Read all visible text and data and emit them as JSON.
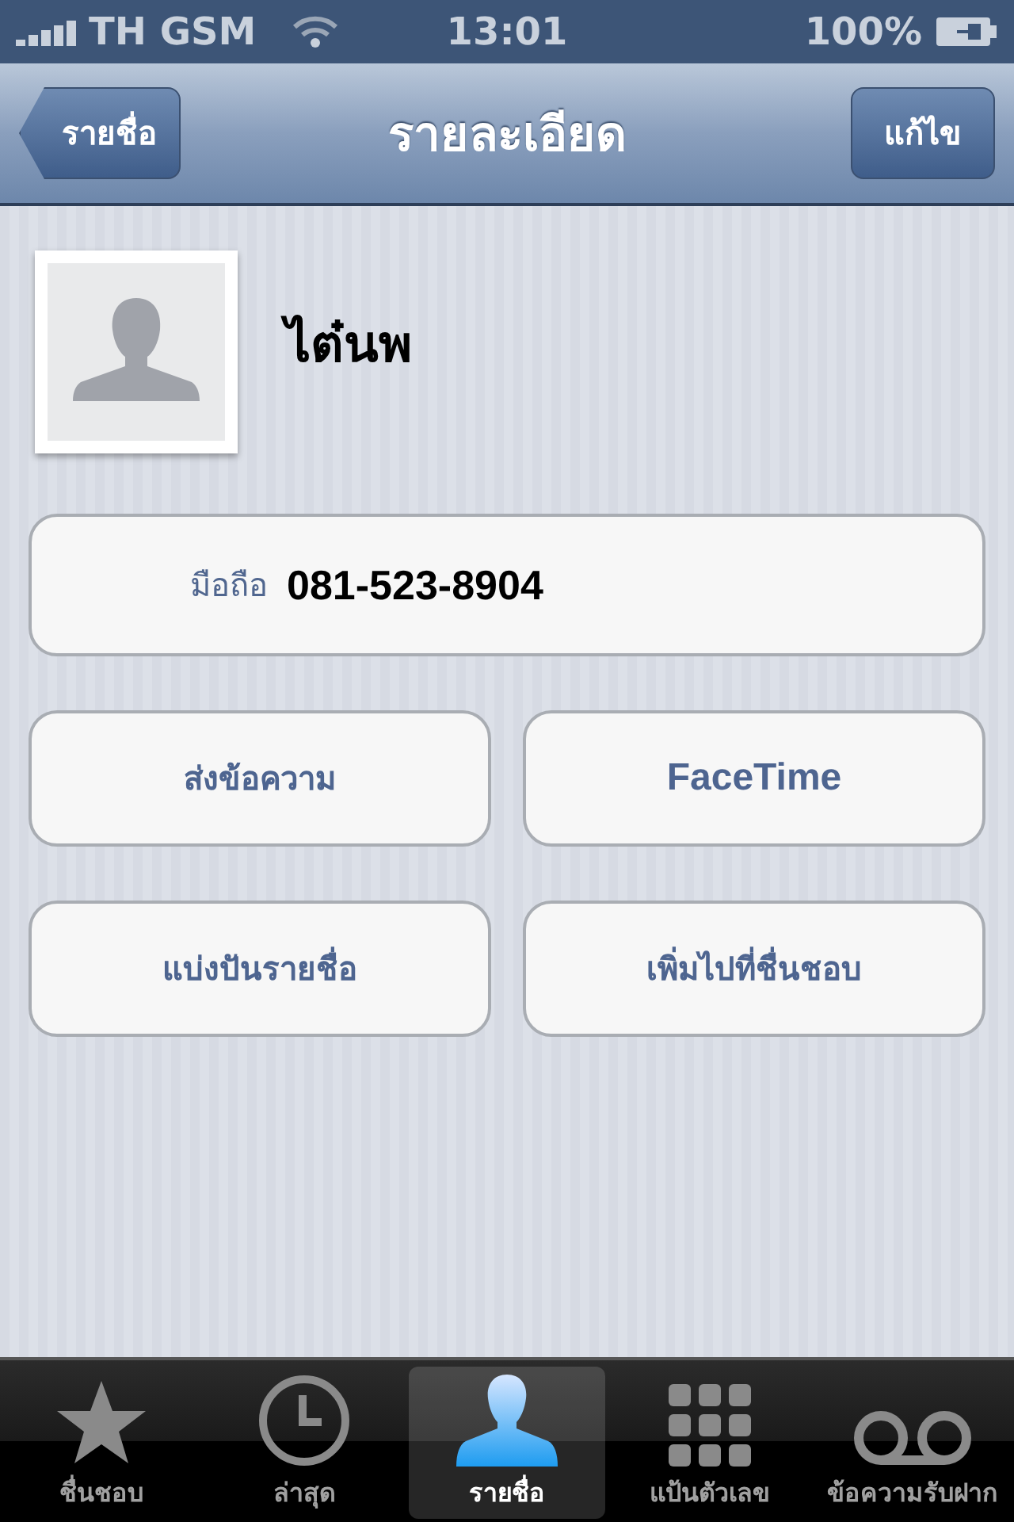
{
  "status_bar": {
    "carrier": "TH GSM",
    "time": "13:01",
    "battery": "100%"
  },
  "nav": {
    "back": "รายชื่อ",
    "title": "รายละเอียด",
    "edit": "แก้ไข"
  },
  "contact": {
    "name": "ไต๋นพ"
  },
  "phone": {
    "label": "มือถือ",
    "number": "081-523-8904"
  },
  "actions": [
    {
      "label": "ส่งข้อความ",
      "kind": "thai"
    },
    {
      "label": "FaceTime",
      "kind": "latin"
    },
    {
      "label": "แบ่งปันรายชื่อ",
      "kind": "thai"
    },
    {
      "label": "เพิ่มไปที่ชื่นชอบ",
      "kind": "thai"
    }
  ],
  "tabs": [
    {
      "label": "ชื่นชอบ",
      "kind": "star",
      "selected": false
    },
    {
      "label": "ล่าสุด",
      "kind": "clock",
      "selected": false
    },
    {
      "label": "รายชื่อ",
      "kind": "person",
      "selected": true
    },
    {
      "label": "แป้นตัวเลข",
      "kind": "keypad",
      "selected": false
    },
    {
      "label": "ข้อความรับฝาก",
      "kind": "voicemail",
      "selected": false
    }
  ]
}
